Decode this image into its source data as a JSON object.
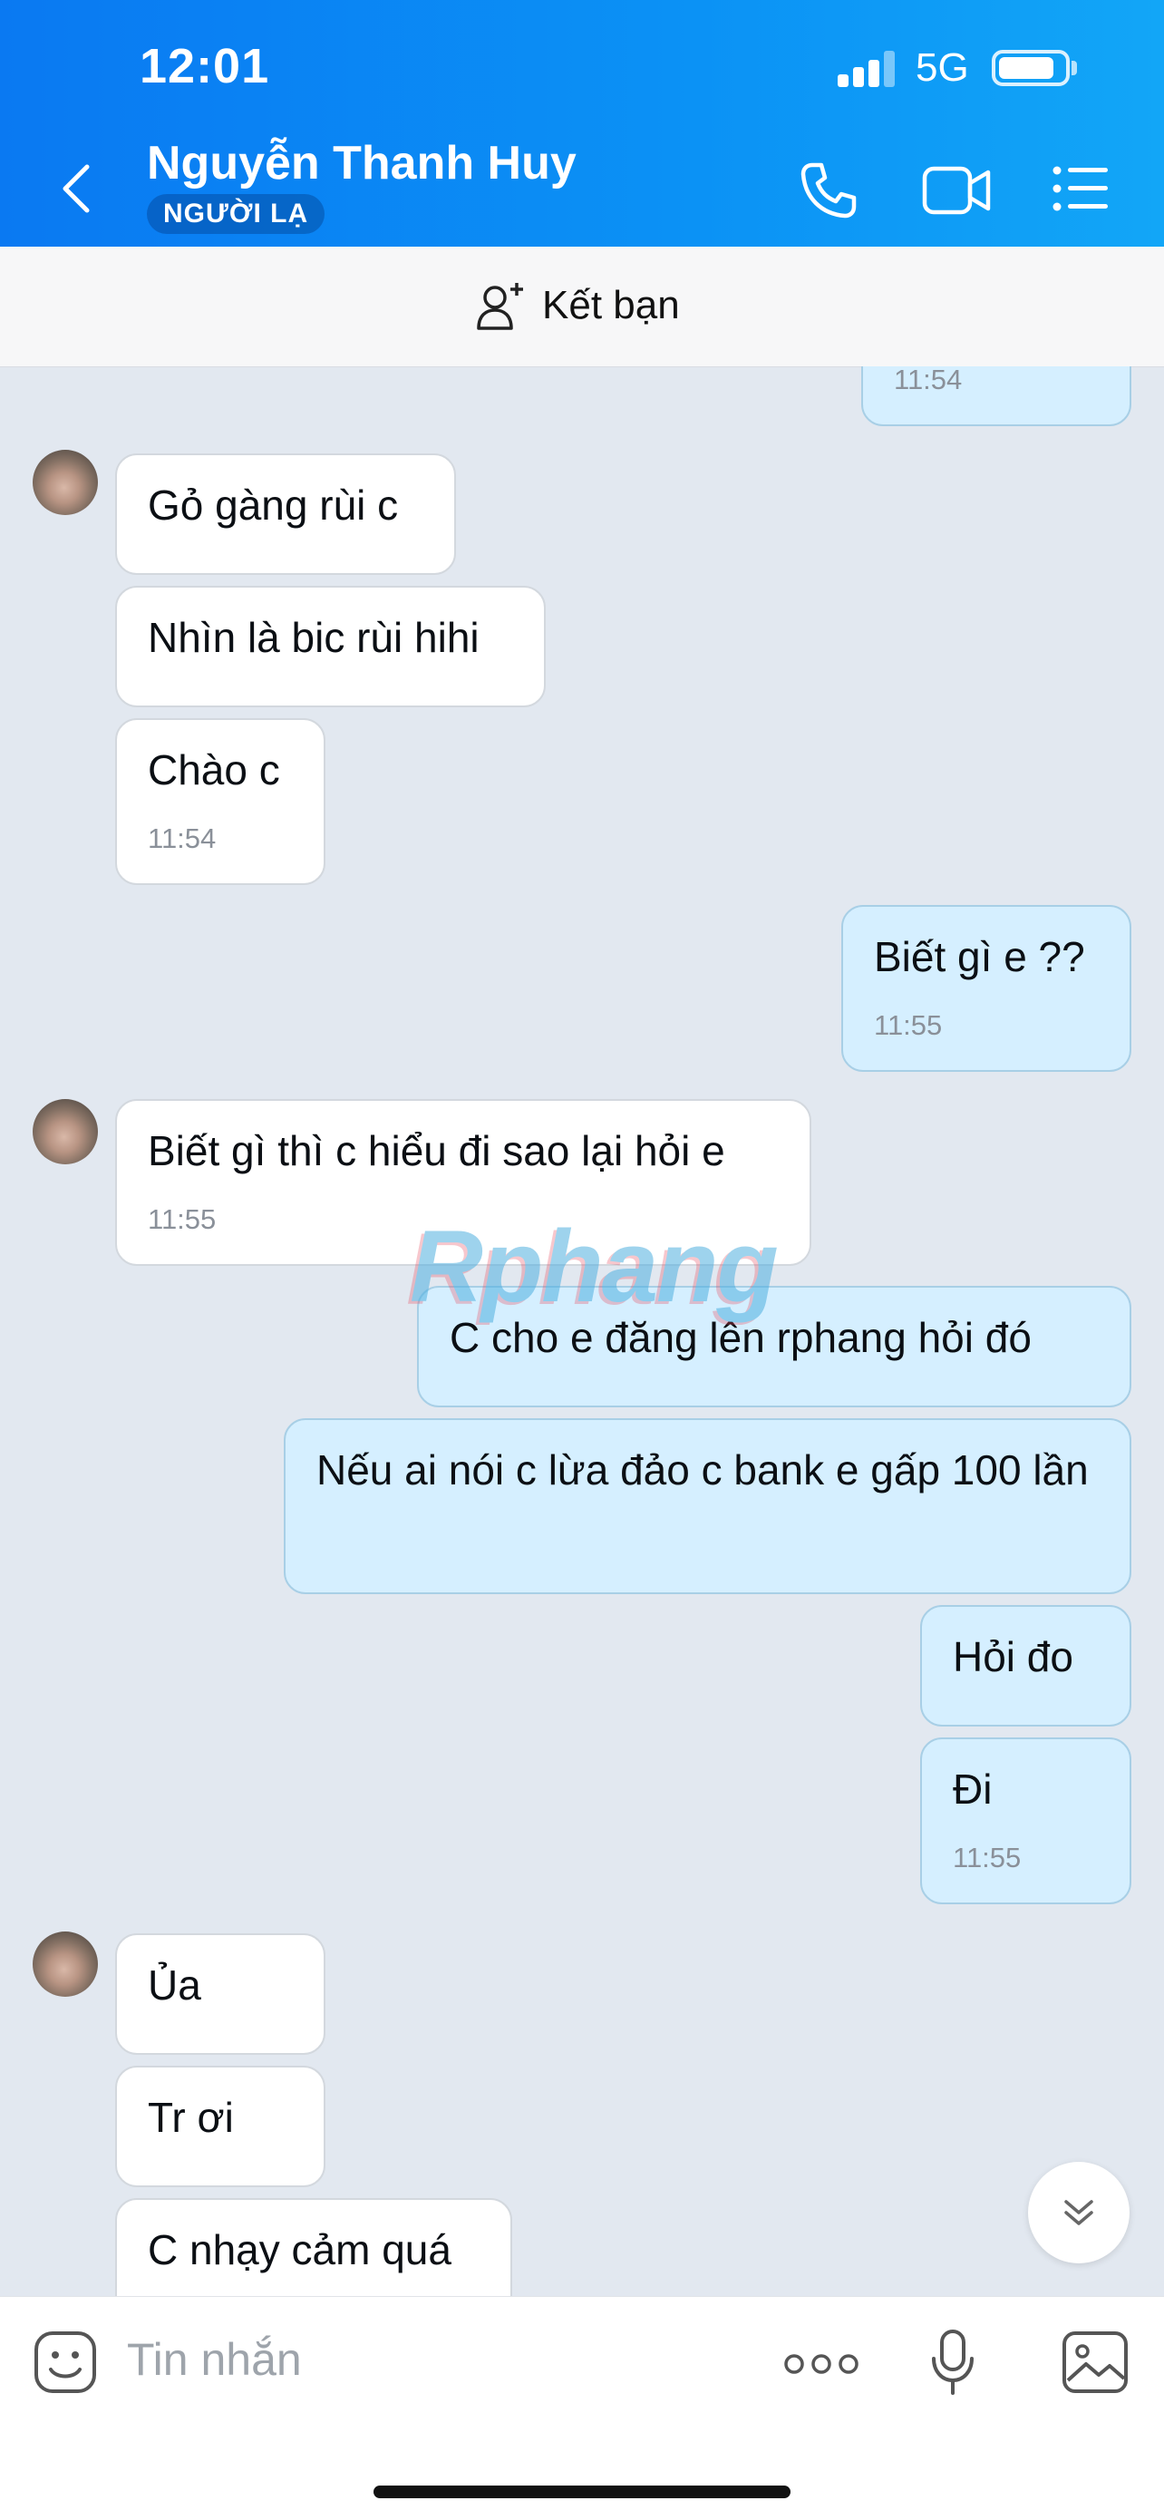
{
  "status_bar": {
    "time": "12:01",
    "network": "5G",
    "battery_level": 0.85
  },
  "header": {
    "contact_name": "Nguyễn Thanh Huy",
    "badge": "NGƯỜI LẠ",
    "icons": [
      "back-icon",
      "phone-icon",
      "video-icon",
      "menu-icon"
    ],
    "color": "#0b8af4"
  },
  "friend_bar": {
    "label": "Kết bạn",
    "icon": "add-person-icon"
  },
  "messages": [
    {
      "from": "me",
      "time": "11:54"
    },
    {
      "from": "them",
      "text": "Gỏ gàng rùi c"
    },
    {
      "from": "them",
      "text": "Nhìn là bic rùi hihi"
    },
    {
      "from": "them",
      "text": "Chào c",
      "time": "11:54"
    },
    {
      "from": "me",
      "text": "Biết gì e ??",
      "time": "11:55"
    },
    {
      "from": "them",
      "text": "Biết gì thì c hiểu đi sao lại hỏi e",
      "time": "11:55"
    },
    {
      "from": "me",
      "text": "C cho e đăng lên rphang hỏi đó"
    },
    {
      "from": "me",
      "text": "Nếu ai nói c lừa đảo c bank e gấp 100 lần"
    },
    {
      "from": "me",
      "text": "Hỏi đo"
    },
    {
      "from": "me",
      "text": "Đi",
      "time": "11:55"
    },
    {
      "from": "them",
      "text": "Ủa"
    },
    {
      "from": "them",
      "text": "Tr ơi"
    },
    {
      "from": "them",
      "text": "C nhạy cảm quá"
    }
  ],
  "watermark": "Rphang",
  "composer": {
    "placeholder": "Tin nhắn",
    "icons": [
      "emoji-icon",
      "more-icon",
      "microphone-icon",
      "image-icon"
    ]
  },
  "colors": {
    "outgoing_bubble": "#d5efff",
    "incoming_bubble": "#ffffff",
    "chat_bg": "#e2e8f0"
  }
}
